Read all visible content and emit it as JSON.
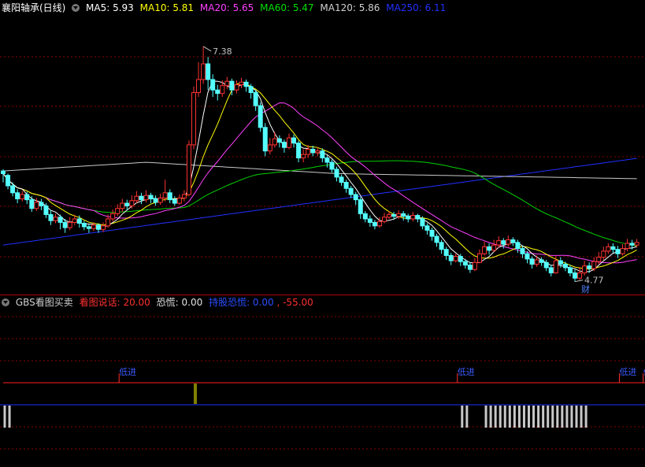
{
  "header": {
    "stock": "襄阳轴承(日线)",
    "ma": [
      {
        "label": "MA5: 5.93",
        "color": "#ffffff"
      },
      {
        "label": "MA10: 5.81",
        "color": "#ffff00"
      },
      {
        "label": "MA20: 5.65",
        "color": "#ff40ff"
      },
      {
        "label": "MA60: 5.47",
        "color": "#00e000"
      },
      {
        "label": "MA120: 5.86",
        "color": "#d0d0d0"
      },
      {
        "label": "MA250: 6.11",
        "color": "#2030ff"
      }
    ]
  },
  "indicator": {
    "name": "GBS看图买卖",
    "items": [
      {
        "label": "看图说话: 20.00",
        "color": "#ff3030"
      },
      {
        "label": "恐慌: 0.00",
        "color": "#e0e0e0"
      },
      {
        "label": "持股恐慌: 0.00",
        "color": "#2a4dff"
      },
      {
        "label": ", -55.00",
        "color": "#ff3030"
      }
    ],
    "signal_label": "低进",
    "signal_index": [
      24,
      95,
      129,
      134
    ]
  },
  "annotations": {
    "high_label": "7.38",
    "low_label": "4.77",
    "cai_label": "财"
  },
  "colors": {
    "up": "#ff3232",
    "down": "#54ffff",
    "grid": "#8b0000",
    "bg": "#000000"
  },
  "chart_data": {
    "type": "candlestick",
    "y_top": 7.75,
    "y_bottom": 4.55,
    "candles": [
      [
        5.95,
        5.92,
        5.97,
        5.82
      ],
      [
        5.9,
        5.78,
        5.92,
        5.74
      ],
      [
        5.78,
        5.7,
        5.82,
        5.66
      ],
      [
        5.7,
        5.63,
        5.74,
        5.58
      ],
      [
        5.63,
        5.68,
        5.72,
        5.6
      ],
      [
        5.68,
        5.62,
        5.71,
        5.57
      ],
      [
        5.62,
        5.52,
        5.66,
        5.48
      ],
      [
        5.52,
        5.59,
        5.64,
        5.49
      ],
      [
        5.59,
        5.55,
        5.63,
        5.5
      ],
      [
        5.55,
        5.45,
        5.58,
        5.41
      ],
      [
        5.45,
        5.38,
        5.5,
        5.33
      ],
      [
        5.38,
        5.42,
        5.46,
        5.35
      ],
      [
        5.42,
        5.36,
        5.45,
        5.28
      ],
      [
        5.36,
        5.3,
        5.4,
        5.24
      ],
      [
        5.3,
        5.36,
        5.42,
        5.27
      ],
      [
        5.36,
        5.4,
        5.45,
        5.33
      ],
      [
        5.4,
        5.35,
        5.44,
        5.3
      ],
      [
        5.35,
        5.31,
        5.38,
        5.27
      ],
      [
        5.31,
        5.29,
        5.34,
        5.24
      ],
      [
        5.29,
        5.33,
        5.36,
        5.26
      ],
      [
        5.33,
        5.28,
        5.35,
        5.24
      ],
      [
        5.28,
        5.32,
        5.36,
        5.25
      ],
      [
        5.32,
        5.4,
        5.45,
        5.3
      ],
      [
        5.4,
        5.46,
        5.51,
        5.37
      ],
      [
        5.46,
        5.52,
        5.57,
        5.43
      ],
      [
        5.52,
        5.58,
        5.63,
        5.48
      ],
      [
        5.58,
        5.55,
        5.62,
        5.5
      ],
      [
        5.55,
        5.61,
        5.67,
        5.52
      ],
      [
        5.61,
        5.66,
        5.72,
        5.58
      ],
      [
        5.66,
        5.62,
        5.7,
        5.57
      ],
      [
        5.62,
        5.67,
        5.73,
        5.59
      ],
      [
        5.67,
        5.63,
        5.7,
        5.58
      ],
      [
        5.63,
        5.59,
        5.67,
        5.55
      ],
      [
        5.59,
        5.64,
        5.69,
        5.56
      ],
      [
        5.64,
        5.7,
        5.85,
        5.6
      ],
      [
        5.7,
        5.62,
        5.74,
        5.58
      ],
      [
        5.62,
        5.58,
        5.66,
        5.55
      ],
      [
        5.58,
        5.64,
        5.68,
        5.56
      ],
      [
        5.64,
        5.68,
        5.73,
        5.6
      ],
      [
        5.68,
        6.25,
        6.3,
        5.66
      ],
      [
        6.25,
        6.85,
        6.92,
        6.2
      ],
      [
        6.85,
        7.0,
        7.2,
        6.8
      ],
      [
        7.0,
        7.18,
        7.38,
        6.95
      ],
      [
        7.18,
        7.0,
        7.26,
        6.88
      ],
      [
        7.0,
        6.88,
        7.06,
        6.8
      ],
      [
        6.88,
        6.84,
        6.94,
        6.76
      ],
      [
        6.84,
        6.93,
        6.99,
        6.8
      ],
      [
        6.93,
        6.98,
        7.03,
        6.89
      ],
      [
        6.98,
        6.88,
        7.01,
        6.82
      ],
      [
        6.88,
        6.94,
        6.99,
        6.84
      ],
      [
        6.94,
        6.97,
        7.02,
        6.9
      ],
      [
        6.97,
        6.92,
        7.0,
        6.86
      ],
      [
        6.92,
        6.85,
        6.95,
        6.78
      ],
      [
        6.85,
        6.7,
        6.88,
        6.64
      ],
      [
        6.7,
        6.45,
        6.74,
        6.4
      ],
      [
        6.45,
        6.18,
        6.5,
        6.12
      ],
      [
        6.18,
        6.25,
        6.33,
        6.14
      ],
      [
        6.25,
        6.32,
        6.4,
        6.22
      ],
      [
        6.32,
        6.28,
        6.36,
        6.22
      ],
      [
        6.28,
        6.22,
        6.31,
        6.16
      ],
      [
        6.22,
        6.33,
        6.38,
        6.2
      ],
      [
        6.33,
        6.27,
        6.37,
        6.22
      ],
      [
        6.27,
        6.1,
        6.3,
        6.05
      ],
      [
        6.1,
        6.14,
        6.2,
        6.05
      ],
      [
        6.14,
        6.2,
        6.25,
        6.1
      ],
      [
        6.2,
        6.16,
        6.24,
        6.12
      ],
      [
        6.16,
        6.18,
        6.22,
        6.12
      ],
      [
        6.18,
        6.1,
        6.21,
        6.05
      ],
      [
        6.1,
        6.05,
        6.13,
        5.99
      ],
      [
        6.05,
        5.97,
        6.08,
        5.93
      ],
      [
        5.97,
        5.88,
        6.0,
        5.83
      ],
      [
        5.88,
        5.82,
        5.91,
        5.78
      ],
      [
        5.82,
        5.75,
        5.85,
        5.7
      ],
      [
        5.75,
        5.68,
        5.78,
        5.64
      ],
      [
        5.68,
        5.62,
        5.71,
        5.56
      ],
      [
        5.62,
        5.46,
        5.65,
        5.4
      ],
      [
        5.46,
        5.4,
        5.49,
        5.36
      ],
      [
        5.4,
        5.36,
        5.44,
        5.31
      ],
      [
        5.36,
        5.32,
        5.39,
        5.28
      ],
      [
        5.32,
        5.37,
        5.42,
        5.3
      ],
      [
        5.37,
        5.42,
        5.47,
        5.35
      ],
      [
        5.42,
        5.45,
        5.49,
        5.4
      ],
      [
        5.45,
        5.43,
        5.48,
        5.39
      ],
      [
        5.43,
        5.46,
        5.5,
        5.4
      ],
      [
        5.46,
        5.43,
        5.49,
        5.38
      ],
      [
        5.43,
        5.4,
        5.46,
        5.36
      ],
      [
        5.4,
        5.44,
        5.48,
        5.37
      ],
      [
        5.44,
        5.4,
        5.46,
        5.36
      ],
      [
        5.4,
        5.32,
        5.43,
        5.28
      ],
      [
        5.32,
        5.27,
        5.35,
        5.22
      ],
      [
        5.27,
        5.2,
        5.3,
        5.15
      ],
      [
        5.2,
        5.13,
        5.23,
        5.08
      ],
      [
        5.13,
        5.05,
        5.16,
        5.0
      ],
      [
        5.05,
        4.98,
        5.08,
        4.93
      ],
      [
        4.98,
        4.92,
        5.01,
        4.87
      ],
      [
        4.92,
        4.97,
        5.0,
        4.9
      ],
      [
        4.97,
        4.91,
        5.0,
        4.86
      ],
      [
        4.91,
        4.87,
        4.94,
        4.83
      ],
      [
        4.87,
        4.82,
        4.9,
        4.78
      ],
      [
        4.82,
        4.9,
        4.95,
        4.8
      ],
      [
        4.9,
        5.0,
        5.05,
        4.89
      ],
      [
        5.0,
        5.08,
        5.14,
        4.98
      ],
      [
        5.08,
        5.04,
        5.12,
        4.99
      ],
      [
        5.04,
        5.1,
        5.16,
        5.02
      ],
      [
        5.1,
        5.15,
        5.2,
        5.07
      ],
      [
        5.15,
        5.11,
        5.18,
        5.06
      ],
      [
        5.11,
        5.16,
        5.21,
        5.08
      ],
      [
        5.16,
        5.13,
        5.19,
        5.09
      ],
      [
        5.13,
        5.06,
        5.16,
        5.01
      ],
      [
        5.06,
        5.0,
        5.09,
        4.95
      ],
      [
        5.0,
        4.94,
        5.03,
        4.89
      ],
      [
        4.94,
        4.88,
        4.97,
        4.83
      ],
      [
        4.88,
        4.93,
        4.98,
        4.85
      ],
      [
        4.93,
        4.9,
        4.96,
        4.86
      ],
      [
        4.9,
        4.84,
        4.93,
        4.8
      ],
      [
        4.84,
        4.78,
        4.87,
        4.74
      ],
      [
        4.78,
        4.92,
        4.97,
        4.77
      ],
      [
        4.92,
        4.88,
        4.96,
        4.84
      ],
      [
        4.88,
        4.84,
        4.91,
        4.8
      ],
      [
        4.84,
        4.78,
        4.87,
        4.74
      ],
      [
        4.78,
        4.72,
        4.82,
        4.68
      ],
      [
        4.72,
        4.78,
        4.85,
        4.7
      ],
      [
        4.78,
        4.86,
        4.92,
        4.75
      ],
      [
        4.86,
        4.83,
        4.9,
        4.78
      ],
      [
        4.83,
        4.91,
        4.96,
        4.8
      ],
      [
        4.91,
        4.96,
        5.02,
        4.88
      ],
      [
        4.96,
        5.03,
        5.08,
        4.93
      ],
      [
        5.03,
        5.08,
        5.12,
        5.0
      ],
      [
        5.08,
        5.05,
        5.12,
        5.01
      ],
      [
        5.05,
        5.0,
        5.09,
        4.95
      ],
      [
        5.0,
        5.06,
        5.11,
        4.98
      ],
      [
        5.06,
        5.12,
        5.17,
        5.03
      ],
      [
        5.12,
        5.1,
        5.16,
        5.05
      ],
      [
        5.1,
        5.13,
        5.17,
        5.07
      ]
    ],
    "ma250": [
      [
        0,
        5.1
      ],
      [
        135,
        6.11
      ]
    ],
    "ma120": [
      [
        0,
        5.95
      ],
      [
        30,
        6.05
      ],
      [
        70,
        5.92
      ],
      [
        135,
        5.86
      ]
    ]
  }
}
